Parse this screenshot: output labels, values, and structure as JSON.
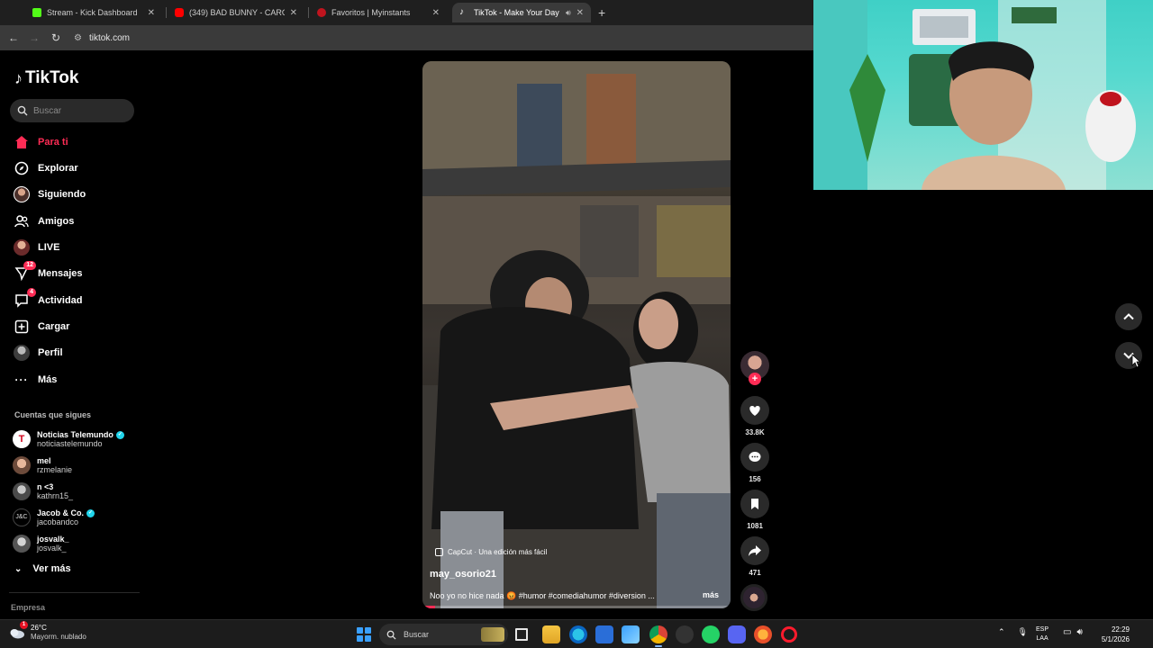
{
  "browser": {
    "tabs": [
      {
        "title": "Stream - Kick Dashboard",
        "favicon_color": "#53fc18",
        "active": false
      },
      {
        "title": "(349) BAD BUNNY - CARO | X100",
        "favicon_color": "#ff0000",
        "active": false
      },
      {
        "title": "Favoritos | Myinstants",
        "favicon_color": "#c0141e",
        "active": false
      },
      {
        "title": "TikTok - Make Your Day",
        "favicon_color": "#ffffff",
        "active": true
      }
    ],
    "new_tab_icon": "plus-icon",
    "url": "tiktok.com"
  },
  "sidebar": {
    "logo_text": "TikTok",
    "search_placeholder": "Buscar",
    "nav": [
      {
        "label": "Para ti",
        "icon": "home-icon",
        "active": true
      },
      {
        "label": "Explorar",
        "icon": "compass-icon"
      },
      {
        "label": "Siguiendo",
        "icon": "following-avatar-icon"
      },
      {
        "label": "Amigos",
        "icon": "friends-icon"
      },
      {
        "label": "LIVE",
        "icon": "live-avatar-icon"
      },
      {
        "label": "Mensajes",
        "icon": "messages-icon",
        "badge": "12"
      },
      {
        "label": "Actividad",
        "icon": "activity-icon",
        "badge": "4"
      },
      {
        "label": "Cargar",
        "icon": "upload-icon"
      },
      {
        "label": "Perfil",
        "icon": "profile-avatar-icon"
      },
      {
        "label": "Más",
        "icon": "more-icon"
      }
    ],
    "following_title": "Cuentas que sigues",
    "accounts": [
      {
        "name": "Noticias Telemundo",
        "user": "noticiastelemundo",
        "verified": true
      },
      {
        "name": "mel",
        "user": "rzmelanie",
        "verified": false
      },
      {
        "name": "n <3",
        "user": "kathrn15_",
        "verified": false
      },
      {
        "name": "Jacob & Co.",
        "user": "jacobandco",
        "verified": true
      },
      {
        "name": "josvalk_",
        "user": "josvalk_",
        "verified": false
      }
    ],
    "see_more": "Ver más",
    "footer": "Empresa"
  },
  "video": {
    "capcut_label": "CapCut · Una edición más fácil",
    "author": "may_osorio21",
    "caption": "Noo yo no hice nada 😡 #humor #comediahumor #diversion ...",
    "more": "más",
    "progress": 0.04
  },
  "actions": {
    "likes": "33.8K",
    "comments": "156",
    "saves": "1081",
    "shares": "471"
  },
  "taskbar": {
    "weather_temp": "26°C",
    "weather_desc": "Mayorm. nublado",
    "alert_count": "1",
    "search_label": "Buscar",
    "lang_top": "ESP",
    "lang_bottom": "LAA",
    "time": "22:29",
    "date": "5/1/2026"
  },
  "colors": {
    "accent": "#fe2c55",
    "verified": "#20d5ec"
  }
}
